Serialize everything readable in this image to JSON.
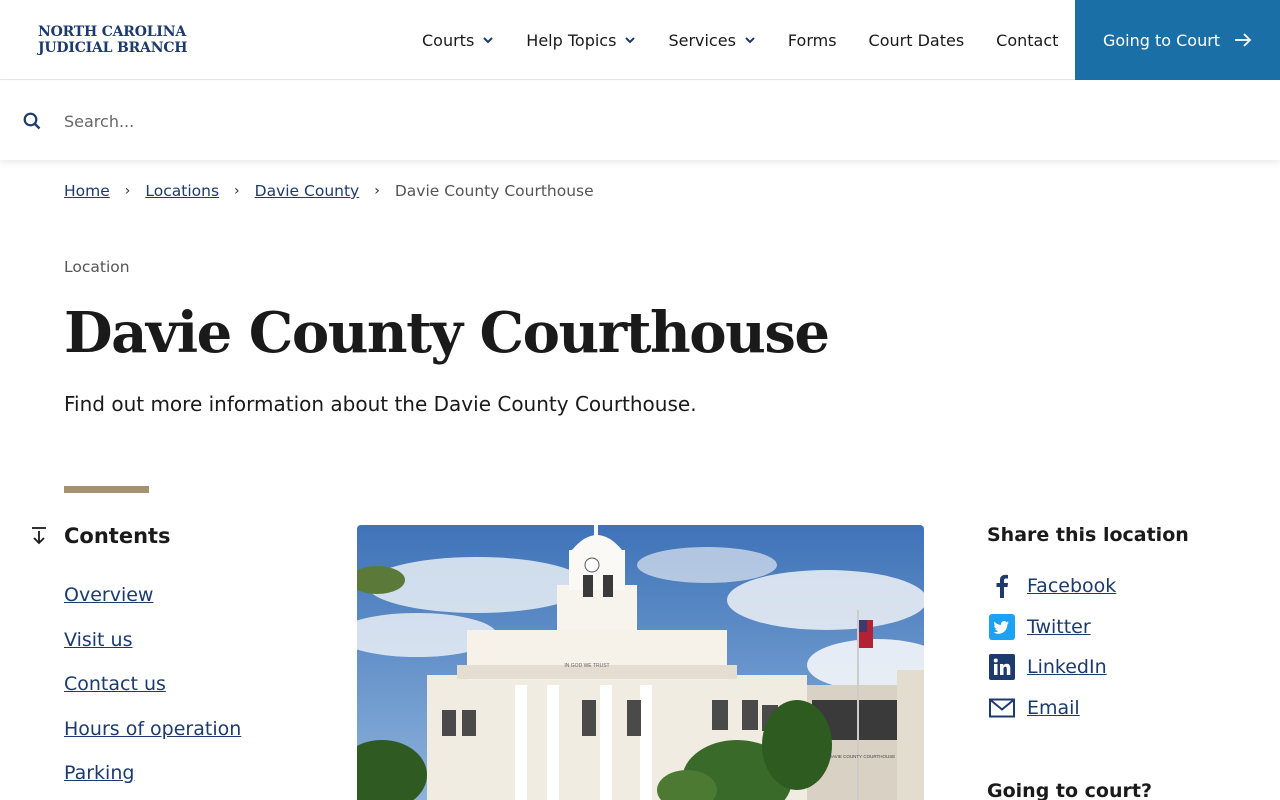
{
  "header": {
    "logo_line1": "NORTH CAROLINA",
    "logo_line2": "JUDICIAL BRANCH",
    "nav": [
      {
        "label": "Courts",
        "dropdown": true
      },
      {
        "label": "Help Topics",
        "dropdown": true
      },
      {
        "label": "Services",
        "dropdown": true
      },
      {
        "label": "Forms",
        "dropdown": false
      },
      {
        "label": "Court Dates",
        "dropdown": false
      },
      {
        "label": "Contact",
        "dropdown": false
      }
    ],
    "cta_label": "Going to Court"
  },
  "search": {
    "placeholder": "Search..."
  },
  "breadcrumb": {
    "items": [
      "Home",
      "Locations",
      "Davie County"
    ],
    "current": "Davie County Courthouse"
  },
  "page": {
    "eyebrow": "Location",
    "title": "Davie County Courthouse",
    "subtitle": "Find out more information about the Davie County Courthouse."
  },
  "contents": {
    "heading": "Contents",
    "items": [
      "Overview",
      "Visit us",
      "Contact us",
      "Hours of operation",
      "Parking"
    ]
  },
  "photo": {
    "sign_text": "IN GOD WE TRUST",
    "building_sign": "DAVIE COUNTY COURTHOUSE"
  },
  "share": {
    "heading": "Share this location",
    "items": [
      {
        "label": "Facebook",
        "icon": "facebook-icon"
      },
      {
        "label": "Twitter",
        "icon": "twitter-icon"
      },
      {
        "label": "LinkedIn",
        "icon": "linkedin-icon"
      },
      {
        "label": "Email",
        "icon": "email-icon"
      }
    ]
  },
  "going_to_court": {
    "heading": "Going to court?"
  },
  "colors": {
    "brand_navy": "#1c3a6e",
    "cta_blue": "#1a70a6",
    "accent_gold": "#a69272"
  }
}
